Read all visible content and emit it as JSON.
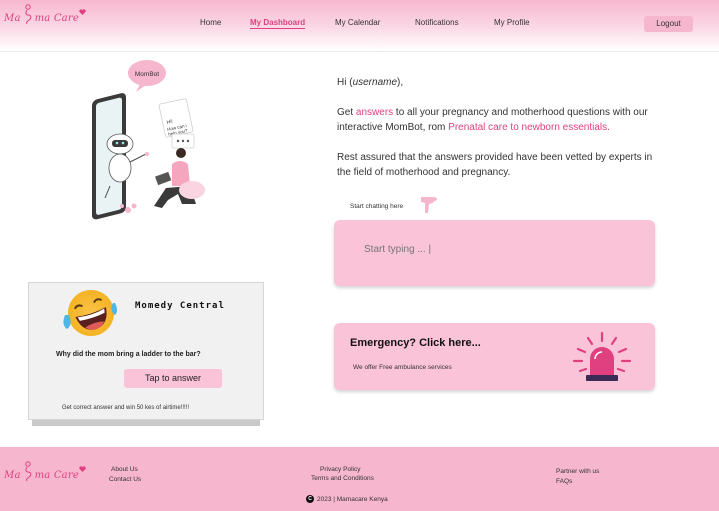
{
  "brand": {
    "logo_text": "Mama Care",
    "accent": "#e0407f",
    "pink": "#fbc3d8"
  },
  "nav": {
    "items": [
      {
        "label": "Home"
      },
      {
        "label": "My Dashboard",
        "active": true
      },
      {
        "label": "My Calendar"
      },
      {
        "label": "Notifications"
      },
      {
        "label": "My Profile"
      }
    ],
    "logout_label": "Logout"
  },
  "illustration": {
    "bubble_label": "MomBot",
    "screen_text": "Hi! How can i help you?"
  },
  "greeting": {
    "hi_prefix": "Hi (",
    "username": "username",
    "hi_suffix": "),",
    "line1_a": "Get ",
    "line1_link": "answers",
    "line1_b": " to all your pregnancy and motherhood questions with our interactive MomBot, rom ",
    "line1_link2": "Prenatal care to newborn essentials.",
    "line2": "Rest assured that the answers provided have been vetted by experts in the field of motherhood and pregnancy."
  },
  "chat": {
    "label": "Start chatting here",
    "placeholder": "Start typing ... |"
  },
  "emergency": {
    "title": "Emergency? Click here...",
    "subtitle": "We offer Free ambulance services"
  },
  "momedy": {
    "title": "Momedy Central",
    "joke": "Why did the mom bring a ladder to the bar?",
    "answer_button": "Tap to answer",
    "footer_note": "Get correct answer and win 50 kes of airtime!!!!!"
  },
  "footer": {
    "about": "About Us",
    "contact": "Contact Us",
    "privacy": "Privacy Policy",
    "terms": "Terms and Conditions",
    "partner": "Partner with us",
    "faqs": "FAQs",
    "copyright": "2023 | Mamacare Kenya"
  },
  "icons": [
    "mama-care-logo-icon",
    "pointer-hand-icon",
    "siren-icon",
    "laughing-emoji-icon",
    "copyright-icon"
  ]
}
